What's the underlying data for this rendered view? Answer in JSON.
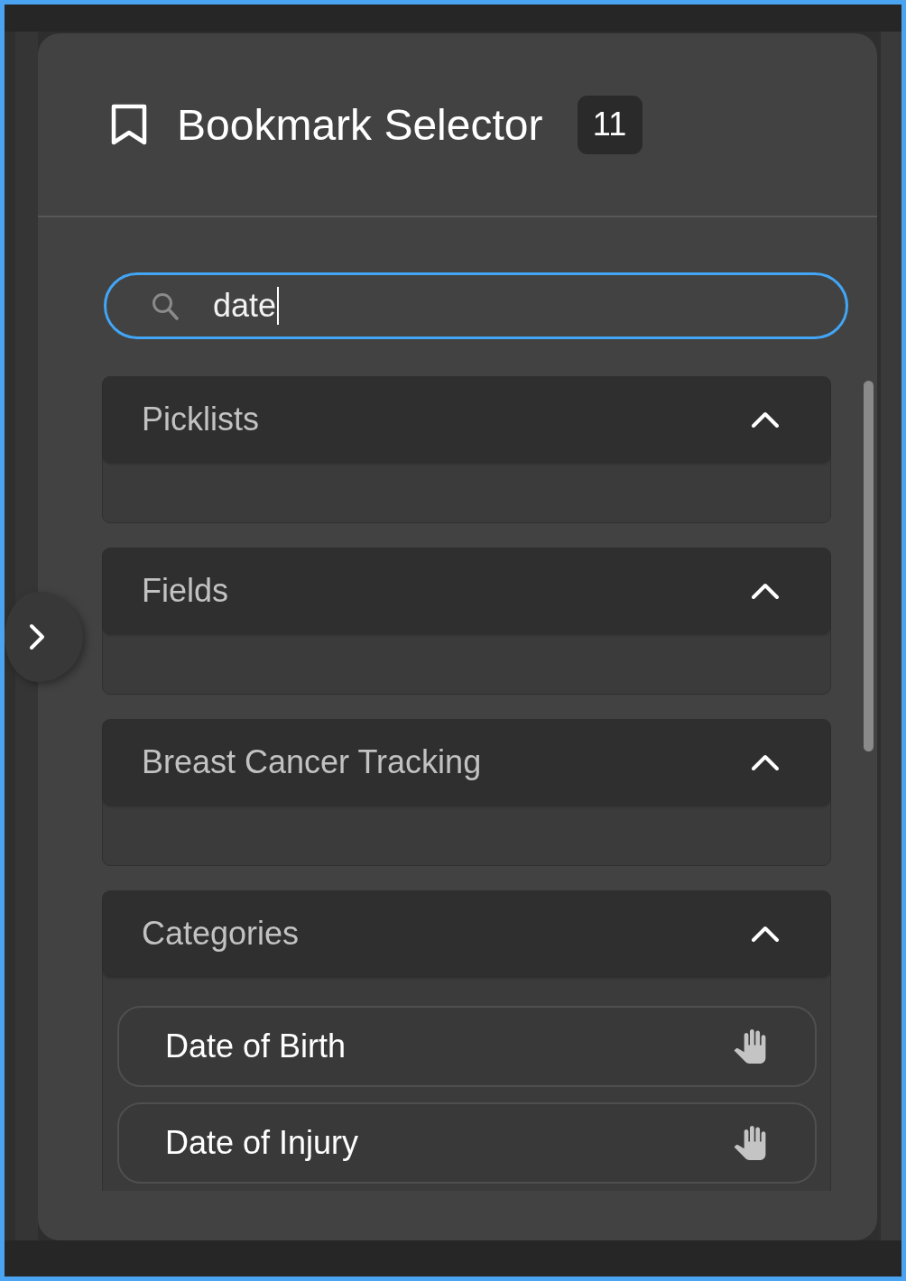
{
  "panel": {
    "title": "Bookmark Selector",
    "count": "11"
  },
  "search": {
    "value": "date",
    "focused": true
  },
  "sections": [
    {
      "title": "Picklists",
      "expanded": true
    },
    {
      "title": "Fields",
      "expanded": true
    },
    {
      "title": "Breast Cancer Tracking",
      "expanded": true
    },
    {
      "title": "Categories",
      "expanded": true,
      "items": [
        {
          "label": "Date of Birth"
        },
        {
          "label": "Date of Injury"
        }
      ]
    }
  ]
}
